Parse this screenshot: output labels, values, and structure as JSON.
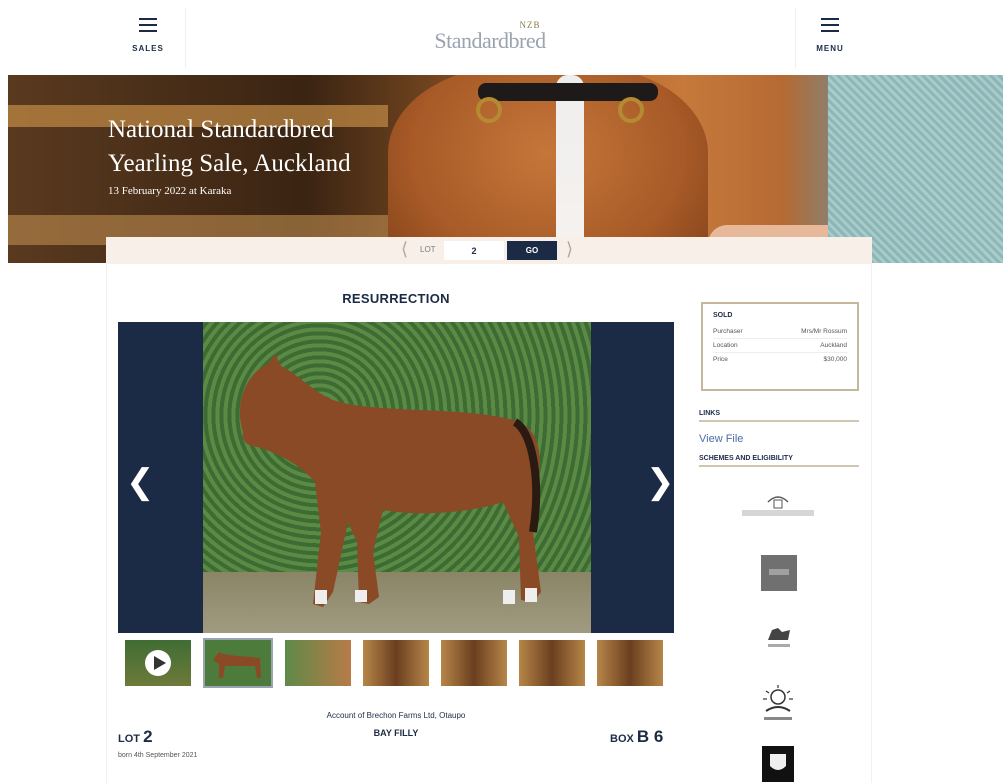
{
  "header": {
    "sales_label": "SALES",
    "menu_label": "MENU",
    "logo_top": "NZB",
    "logo_main": "Standardbred"
  },
  "hero": {
    "title_line1": "National Standardbred",
    "title_line2": "Yearling Sale, Auckland",
    "subtitle": "13 February 2022 at Karaka"
  },
  "lotnav": {
    "label": "LOT",
    "value": "2",
    "go_label": "GO"
  },
  "horse": {
    "name": "RESURRECTION",
    "account": "Account of Brechon Farms Ltd, Otaupo",
    "lot_label": "LOT",
    "lot_number": "2",
    "born": "born 4th September 2021",
    "colour_sex": "BAY FILLY",
    "box_label": "BOX",
    "box_number": "B 6"
  },
  "sold": {
    "title": "SOLD",
    "rows": [
      {
        "label": "Purchaser",
        "value": "Mrs/Mr Rossum"
      },
      {
        "label": "Location",
        "value": "Auckland"
      },
      {
        "label": "Price",
        "value": "$30,000"
      }
    ]
  },
  "links": {
    "title": "LINKS",
    "view_file": "View File"
  },
  "schemes": {
    "title": "SCHEMES AND ELIGIBILITY"
  },
  "colors": {
    "navy": "#1c2b45",
    "gold_border": "#c5b89a",
    "link": "#4a6ea6",
    "nav_bg": "#f7efe8"
  }
}
